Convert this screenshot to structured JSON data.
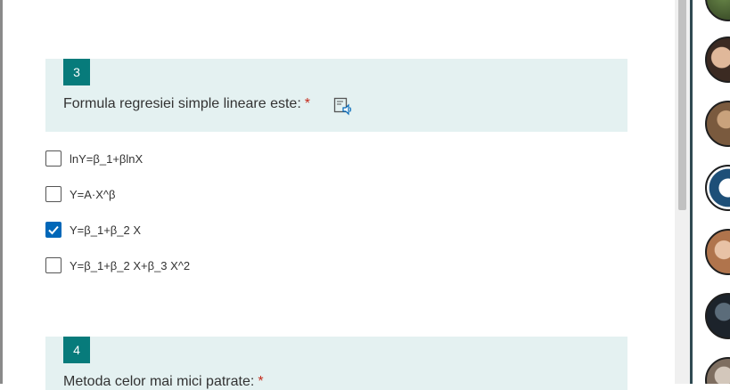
{
  "questions": [
    {
      "number": "3",
      "title": "Formula regresiei simple lineare este:",
      "required_mark": "*",
      "options": [
        {
          "label": "lnY=β_1+βlnX",
          "checked": false
        },
        {
          "label": "Y=A·X^β",
          "checked": false
        },
        {
          "label": "Y=β_1+β_2 X",
          "checked": true
        },
        {
          "label": "Y=β_1+β_2 X+β_3 X^2",
          "checked": false
        }
      ]
    },
    {
      "number": "4",
      "title": "Metoda celor mai mici patrate:",
      "required_mark": "*"
    }
  ],
  "icons": {
    "reader": "immersive-reader-icon",
    "check": "checkmark-icon"
  },
  "colors": {
    "accent": "#077b7b",
    "card_background": "#e4f1f1",
    "checkbox_checked": "#0067b8",
    "required": "#c42b1c"
  },
  "side_panel": {
    "avatars": [
      "avatar",
      "avatar",
      "avatar",
      "avatar",
      "avatar",
      "avatar",
      "avatar"
    ]
  }
}
